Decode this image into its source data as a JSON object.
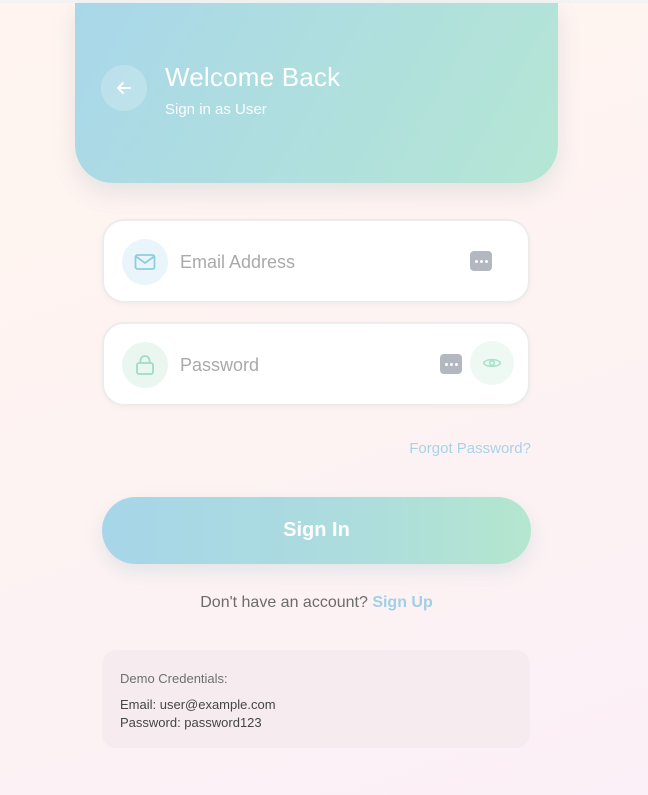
{
  "header": {
    "title": "Welcome Back",
    "subtitle": "Sign in as User",
    "back_icon": "arrow-left-icon"
  },
  "form": {
    "email": {
      "placeholder": "Email Address",
      "value": "",
      "icon": "mail-icon",
      "icon_color": "#8ccde4"
    },
    "password": {
      "placeholder": "Password",
      "value": "",
      "icon": "lock-icon",
      "icon_color": "#9fdcc2",
      "toggle_icon": "eye-icon"
    },
    "forgot_label": "Forgot Password?",
    "submit_label": "Sign In"
  },
  "signup": {
    "prompt": "Don't have an account?",
    "link": "Sign Up"
  },
  "demo": {
    "title": "Demo Credentials:",
    "email_line": "Email: user@example.com",
    "password_line": "Password: password123"
  },
  "colors": {
    "accent_blue": "#a6d6e8",
    "accent_green": "#b4e6cf",
    "link": "#9fd0e6"
  }
}
